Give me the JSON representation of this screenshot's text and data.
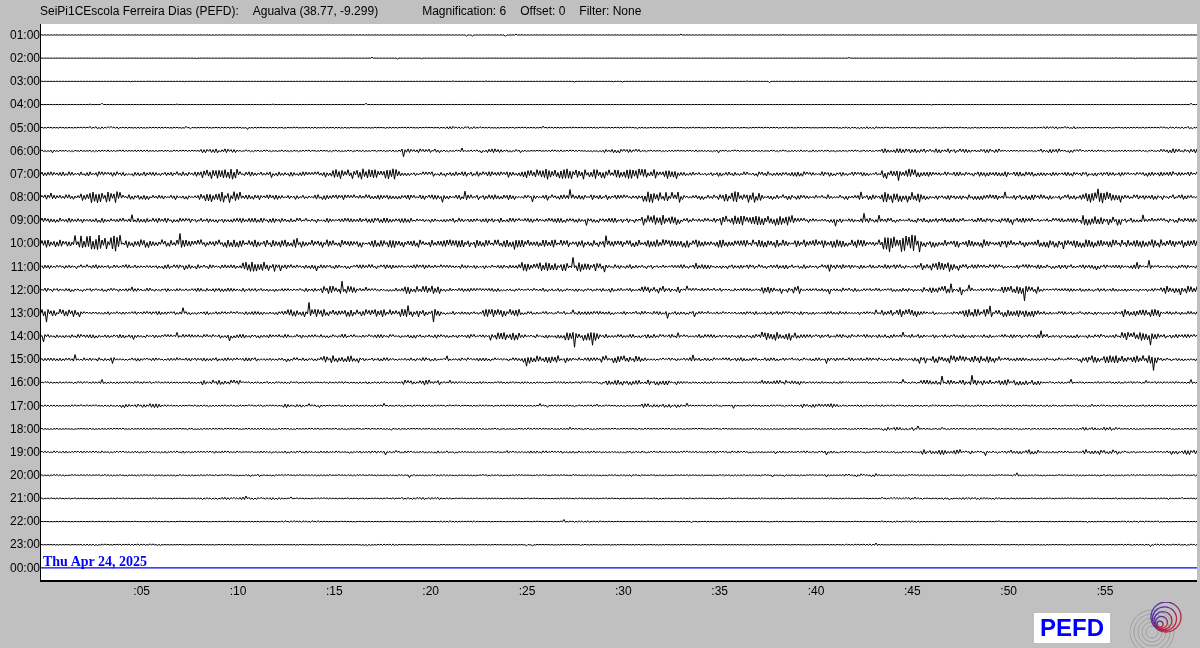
{
  "header": {
    "station": "SeiPi1CEscola Ferreira Dias (PEFD):",
    "location": "Agualva (38.77, -9.299)",
    "magnification": "Magnification: 6",
    "offset": "Offset: 0",
    "filter": "Filter: None"
  },
  "rows": [
    {
      "label": "01:00",
      "kind": "trace"
    },
    {
      "label": "02:00",
      "kind": "trace"
    },
    {
      "label": "03:00",
      "kind": "trace"
    },
    {
      "label": "04:00",
      "kind": "trace"
    },
    {
      "label": "05:00",
      "kind": "trace"
    },
    {
      "label": "06:00",
      "kind": "trace"
    },
    {
      "label": "07:00",
      "kind": "trace"
    },
    {
      "label": "08:00",
      "kind": "trace"
    },
    {
      "label": "09:00",
      "kind": "trace"
    },
    {
      "label": "10:00",
      "kind": "trace"
    },
    {
      "label": "11:00",
      "kind": "trace"
    },
    {
      "label": "12:00",
      "kind": "trace"
    },
    {
      "label": "13:00",
      "kind": "trace"
    },
    {
      "label": "14:00",
      "kind": "trace"
    },
    {
      "label": "15:00",
      "kind": "trace"
    },
    {
      "label": "16:00",
      "kind": "trace"
    },
    {
      "label": "17:00",
      "kind": "trace"
    },
    {
      "label": "18:00",
      "kind": "trace"
    },
    {
      "label": "19:00",
      "kind": "trace"
    },
    {
      "label": "20:00",
      "kind": "trace"
    },
    {
      "label": "21:00",
      "kind": "trace"
    },
    {
      "label": "22:00",
      "kind": "trace"
    },
    {
      "label": "23:00",
      "kind": "trace"
    },
    {
      "label": "00:00",
      "kind": "current"
    }
  ],
  "date_label": "Thu Apr 24, 2025",
  "x_ticks": [
    ":05",
    ":10",
    ":15",
    ":20",
    ":25",
    ":30",
    ":35",
    ":40",
    ":45",
    ":50",
    ":55"
  ],
  "logo": {
    "text": "PEFD"
  }
}
